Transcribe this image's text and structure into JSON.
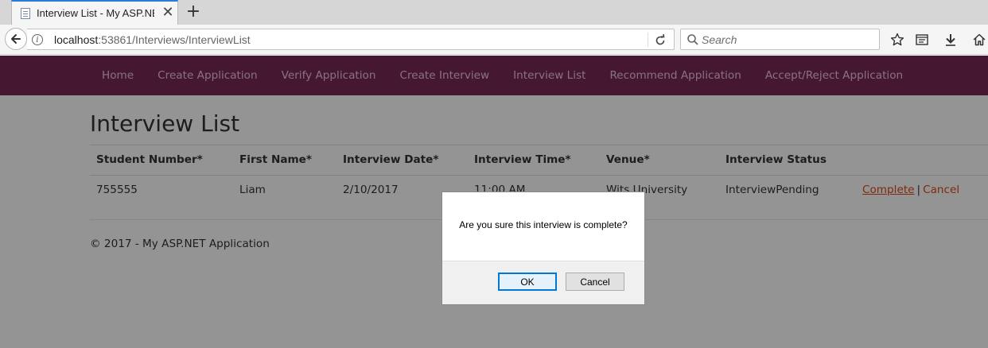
{
  "browser": {
    "tab_title": "Interview List - My ASP.NET",
    "tab_close": "✕",
    "new_tab": "+",
    "url_host": "localhost",
    "url_path": ":53861/Interviews/InterviewList",
    "search_placeholder": "Search"
  },
  "site": {
    "nav": [
      {
        "label": "Home"
      },
      {
        "label": "Create Application"
      },
      {
        "label": "Verify Application"
      },
      {
        "label": "Create Interview"
      },
      {
        "label": "Interview List"
      },
      {
        "label": "Recommend Application"
      },
      {
        "label": "Accept/Reject Application"
      }
    ],
    "page_title": "Interview List",
    "table": {
      "headers": [
        "Student Number*",
        "First Name*",
        "Interview Date*",
        "Interview Time*",
        "Venue*",
        "Interview Status"
      ],
      "rows": [
        {
          "student_number": "755555",
          "first_name": "Liam",
          "interview_date": "2/10/2017",
          "interview_time": "11:00 AM",
          "venue": "Wits University",
          "status": "InterviewPending",
          "action_complete": "Complete",
          "action_separator": "|",
          "action_cancel": "Cancel"
        }
      ]
    },
    "footer": "© 2017 - My ASP.NET Application",
    "link_color": "#dd4814",
    "nav_color": "#772953"
  },
  "dialog": {
    "message": "Are you sure this interview is complete?",
    "ok_label": "OK",
    "cancel_label": "Cancel"
  }
}
